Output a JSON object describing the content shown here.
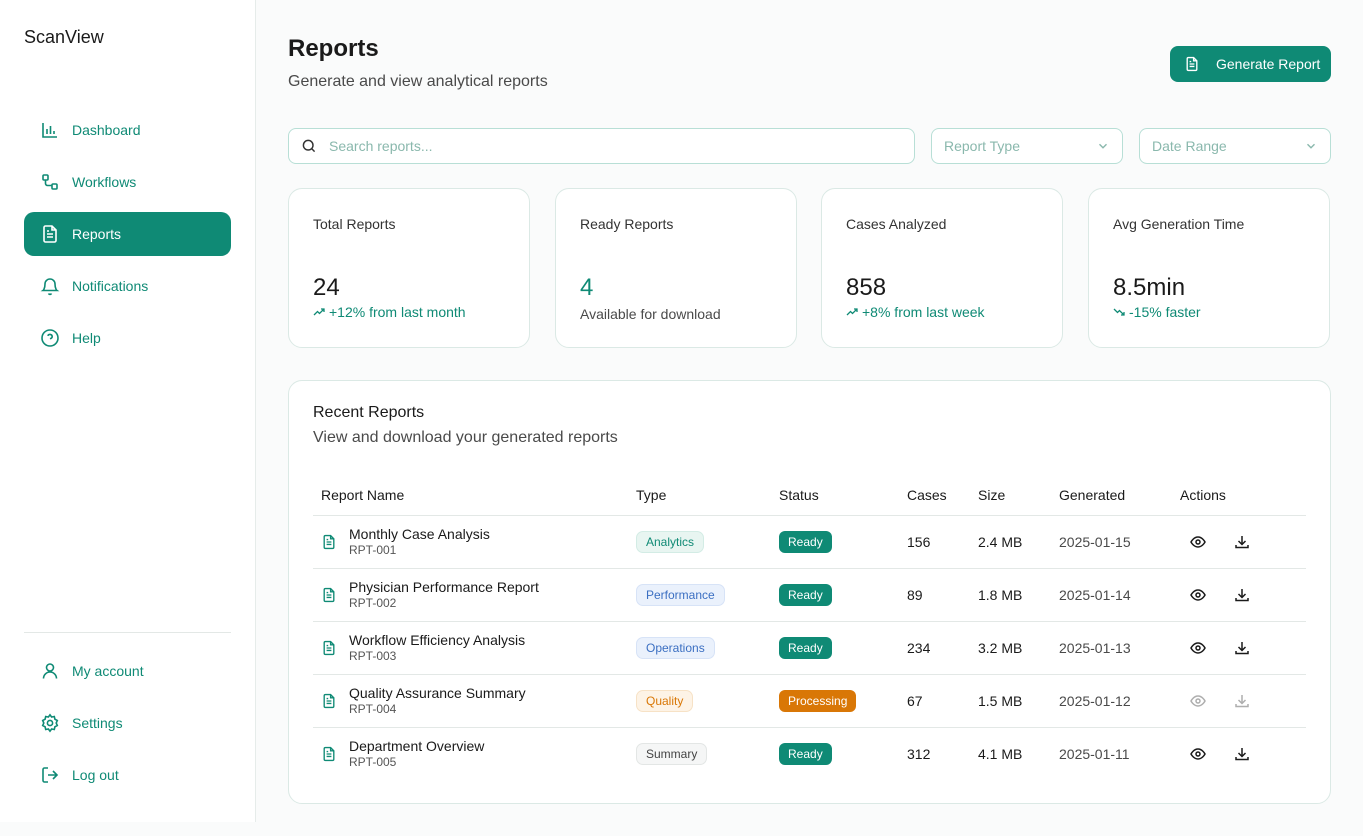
{
  "brand": "ScanView",
  "colors": {
    "accent": "#0f8a75",
    "processing": "#d97706"
  },
  "nav": [
    {
      "label": "Dashboard",
      "icon": "bar-chart-icon",
      "active": false
    },
    {
      "label": "Workflows",
      "icon": "workflow-icon",
      "active": false
    },
    {
      "label": "Reports",
      "icon": "file-text-icon",
      "active": true
    },
    {
      "label": "Notifications",
      "icon": "bell-icon",
      "active": false
    },
    {
      "label": "Help",
      "icon": "help-circle-icon",
      "active": false
    }
  ],
  "nav_bottom": [
    {
      "label": "My account",
      "icon": "user-icon"
    },
    {
      "label": "Settings",
      "icon": "gear-icon"
    },
    {
      "label": "Log out",
      "icon": "logout-icon"
    }
  ],
  "header": {
    "title": "Reports",
    "subtitle": "Generate and view analytical reports",
    "generate_label": "Generate Report"
  },
  "filters": {
    "search_placeholder": "Search reports...",
    "report_type": "Report Type",
    "date_range": "Date Range"
  },
  "stats": [
    {
      "label": "Total Reports",
      "value": "24",
      "note": "+12% from last month",
      "trend": "up"
    },
    {
      "label": "Ready Reports",
      "value": "4",
      "note": "Available for download",
      "trend": "none"
    },
    {
      "label": "Cases Analyzed",
      "value": "858",
      "note": "+8% from last week",
      "trend": "up"
    },
    {
      "label": "Avg Generation Time",
      "value": "8.5min",
      "note": "-15% faster",
      "trend": "down"
    }
  ],
  "recent": {
    "title": "Recent Reports",
    "subtitle": "View and download your generated reports",
    "columns": [
      "Report Name",
      "Type",
      "Status",
      "Cases",
      "Size",
      "Generated",
      "Actions"
    ],
    "rows": [
      {
        "name": "Monthly Case Analysis",
        "id": "RPT-001",
        "type": "Analytics",
        "status": "Ready",
        "cases": "156",
        "size": "2.4 MB",
        "generated": "2025-01-15"
      },
      {
        "name": "Physician Performance Report",
        "id": "RPT-002",
        "type": "Performance",
        "status": "Ready",
        "cases": "89",
        "size": "1.8 MB",
        "generated": "2025-01-14"
      },
      {
        "name": "Workflow Efficiency Analysis",
        "id": "RPT-003",
        "type": "Operations",
        "status": "Ready",
        "cases": "234",
        "size": "3.2 MB",
        "generated": "2025-01-13"
      },
      {
        "name": "Quality Assurance Summary",
        "id": "RPT-004",
        "type": "Quality",
        "status": "Processing",
        "cases": "67",
        "size": "1.5 MB",
        "generated": "2025-01-12"
      },
      {
        "name": "Department Overview",
        "id": "RPT-005",
        "type": "Summary",
        "status": "Ready",
        "cases": "312",
        "size": "4.1 MB",
        "generated": "2025-01-11"
      }
    ]
  }
}
